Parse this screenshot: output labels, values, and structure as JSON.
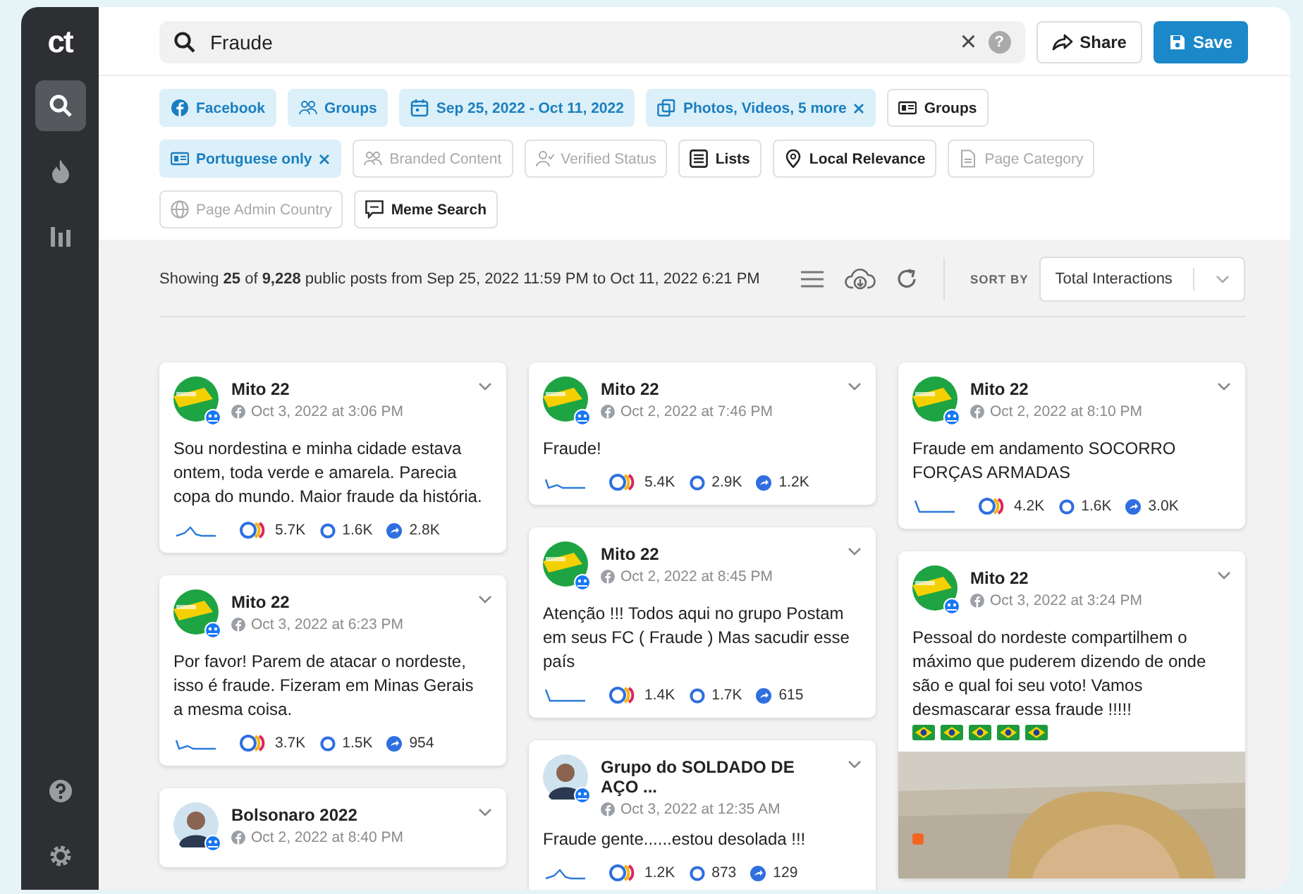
{
  "sidebar": {
    "logo": "ct",
    "items": [
      {
        "kind": "search",
        "selected": true
      },
      {
        "kind": "flame",
        "selected": false
      },
      {
        "kind": "chart",
        "selected": false
      }
    ],
    "bottom_items": [
      {
        "kind": "help"
      },
      {
        "kind": "settings"
      }
    ]
  },
  "search": {
    "value": "Fraude",
    "clear": "×",
    "help": "?"
  },
  "actions": [
    {
      "label": "Share",
      "kind": "secondary"
    },
    {
      "label": "Save",
      "kind": "primary"
    }
  ],
  "filters": [
    {
      "label": "Facebook",
      "kind": "active",
      "removable": false
    },
    {
      "label": "Groups",
      "kind": "active",
      "removable": false
    },
    {
      "label": "Sep 25, 2022 - Oct 11, 2022",
      "kind": "active",
      "removable": false
    },
    {
      "label": "Photos, Videos, 5 more",
      "kind": "active",
      "removable": true
    },
    {
      "label": "Groups",
      "kind": "normal",
      "removable": false
    },
    {
      "label": "Portuguese only",
      "kind": "active",
      "removable": true
    },
    {
      "label": "Branded Content",
      "kind": "disabled",
      "removable": false
    },
    {
      "label": "Verified Status",
      "kind": "disabled",
      "removable": false
    },
    {
      "label": "Lists",
      "kind": "normal",
      "removable": false
    },
    {
      "label": "Local Relevance",
      "kind": "normal",
      "removable": false
    },
    {
      "label": "Page Category",
      "kind": "disabled",
      "removable": false
    },
    {
      "label": "Page Admin Country",
      "kind": "disabled",
      "removable": false
    },
    {
      "label": "Meme Search",
      "kind": "normal",
      "removable": false
    }
  ],
  "results": {
    "summary": "Showing **25** of **9,228** public posts from Sep 25, 2022 11:59 PM to Oct 11, 2022 6:21 PM",
    "sort_label": "SORT BY",
    "sort_value": "Total Interactions"
  },
  "columns": [
    [
      {
        "name": "Mito 22",
        "date": "Oct 3, 2022 at 3:06 PM",
        "text": "Sou nordestina e minha cidade estava ontem, toda verde e amarela. Parecia copa do mundo. Maior fraude da história.",
        "reactions": "5.7K",
        "comments": "1.6K",
        "shares": "2.8K"
      },
      {
        "name": "Mito 22",
        "date": "Oct 3, 2022 at 6:23 PM",
        "text": "Por favor! Parem de atacar o nordeste, isso é fraude. Fizeram em Minas Gerais a mesma coisa.",
        "reactions": "3.7K",
        "comments": "1.5K",
        "shares": "954"
      },
      {
        "name": "Bolsonaro 2022",
        "date": "Oct 2, 2022 at 8:40 PM"
      }
    ],
    [
      {
        "name": "Mito 22",
        "date": "Oct 2, 2022 at 7:46 PM",
        "text": "Fraude!",
        "reactions": "5.4K",
        "comments": "2.9K",
        "shares": "1.2K"
      },
      {
        "name": "Mito 22",
        "date": "Oct 2, 2022 at 8:45 PM",
        "text": "Atenção !!! Todos aqui no grupo Postam em seus FC ( Fraude ) Mas sacudir esse país",
        "reactions": "1.4K",
        "comments": "1.7K",
        "shares": "615"
      },
      {
        "name": "Grupo do SOLDADO DE AÇO ...",
        "date": "Oct 3, 2022 at 12:35 AM",
        "text": "Fraude gente......estou desolada !!!",
        "reactions": "1.2K",
        "comments": "873",
        "shares": "129"
      }
    ],
    [
      {
        "name": "Mito 22",
        "date": "Oct 2, 2022 at 8:10 PM",
        "text": "Fraude em andamento SOCORRO FORÇAS ARMADAS",
        "reactions": "4.2K",
        "comments": "1.6K",
        "shares": "3.0K"
      },
      {
        "name": "Mito 22",
        "date": "Oct 3, 2022 at 3:24 PM",
        "text": "Pessoal do nordeste compartilhem o máximo que puderem dizendo de onde são e qual foi seu voto! Vamos desmascarar essa fraude !!!!!"
      }
    ]
  ]
}
